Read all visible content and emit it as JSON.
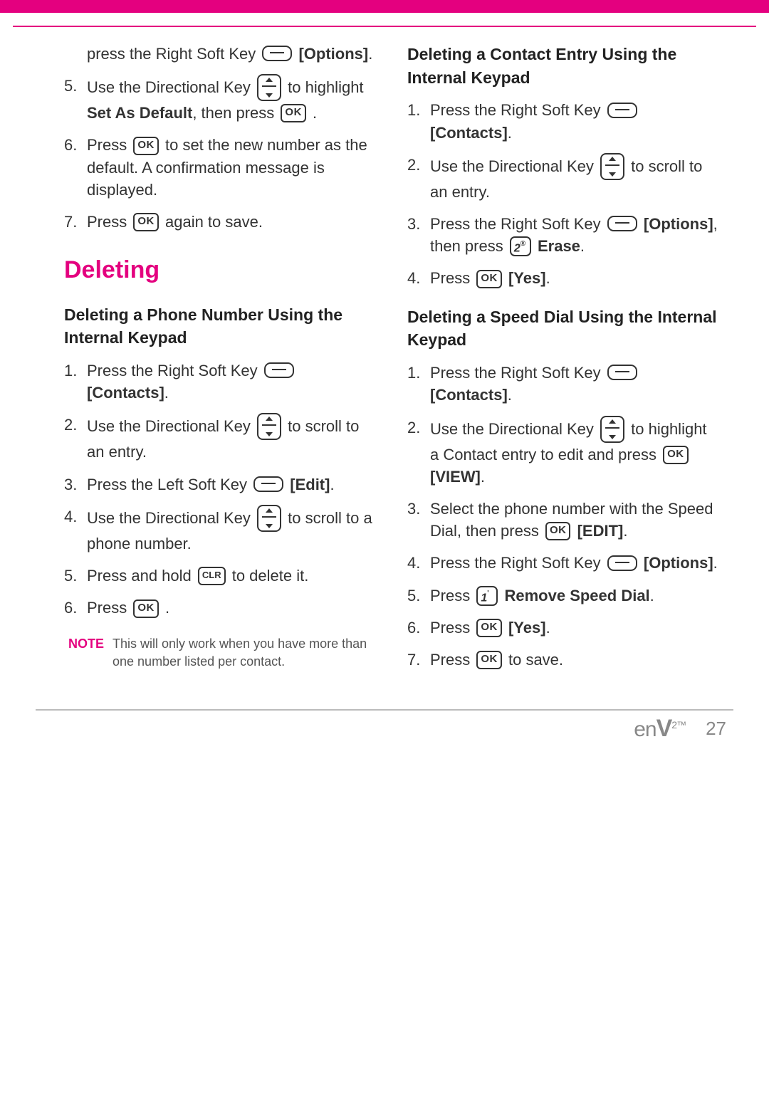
{
  "col1": {
    "cont_step4_a": "press the Right Soft Key ",
    "cont_step4_b": "[Options]",
    "cont_step4_c": ".",
    "s5_a": "Use the Directional Key ",
    "s5_b": " to highlight ",
    "s5_c": "Set As Default",
    "s5_d": ", then press ",
    "s5_e": " .",
    "s6_a": "Press ",
    "s6_b": " to set the new number as the default. A confirmation message is displayed.",
    "s7_a": "Press ",
    "s7_b": " again to save.",
    "h1": "Deleting",
    "h2a": "Deleting a Phone Number Using the Internal Keypad",
    "a1_a": "Press the Right Soft Key ",
    "a1_b": "[Contacts]",
    "a1_c": ".",
    "a2_a": "Use the Directional Key ",
    "a2_b": " to scroll to an entry.",
    "a3_a": "Press the Left Soft Key ",
    "a3_b": "[Edit]",
    "a3_c": ".",
    "a4_a": "Use the Directional Key ",
    "a4_b": " to scroll to a phone number.",
    "a5_a": "Press and hold ",
    "a5_b": " to delete it.",
    "a6_a": "Press ",
    "a6_b": " .",
    "note_label": "NOTE",
    "note_text": "This will only work when you have more than one number listed per contact."
  },
  "col2": {
    "h2b": "Deleting a Contact Entry Using the Internal Keypad",
    "b1_a": "Press the Right Soft Key ",
    "b1_b": "[Contacts]",
    "b1_c": ".",
    "b2_a": "Use the Directional Key ",
    "b2_b": " to scroll to an entry.",
    "b3_a": "Press the Right Soft Key ",
    "b3_b": "[Options]",
    "b3_c": ", then press ",
    "b3_d": "Erase",
    "b3_e": ".",
    "b4_a": "Press ",
    "b4_b": "[Yes]",
    "b4_c": ".",
    "h2c": "Deleting a Speed Dial Using the Internal Keypad",
    "c1_a": "Press the Right Soft Key ",
    "c1_b": "[Contacts]",
    "c1_c": ".",
    "c2_a": "Use the Directional Key ",
    "c2_b": " to highlight a Contact entry to edit and press ",
    "c2_c": "[VIEW]",
    "c2_d": ".",
    "c3_a": "Select the phone number with the Speed Dial, then press ",
    "c3_b": "[EDIT]",
    "c3_c": ".",
    "c4_a": "Press the Right Soft Key ",
    "c4_b": "[Options]",
    "c4_c": ".",
    "c5_a": "Press ",
    "c5_b": "Remove Speed Dial",
    "c5_c": ".",
    "c6_a": "Press ",
    "c6_b": "[Yes]",
    "c6_c": ".",
    "c7_a": "Press ",
    "c7_b": " to save."
  },
  "keys": {
    "ok": "OK",
    "clr": "CLR",
    "num2": "2",
    "num1": "1"
  },
  "footer": {
    "logo": "enV",
    "exp": "2",
    "tm": "™",
    "page": "27"
  }
}
